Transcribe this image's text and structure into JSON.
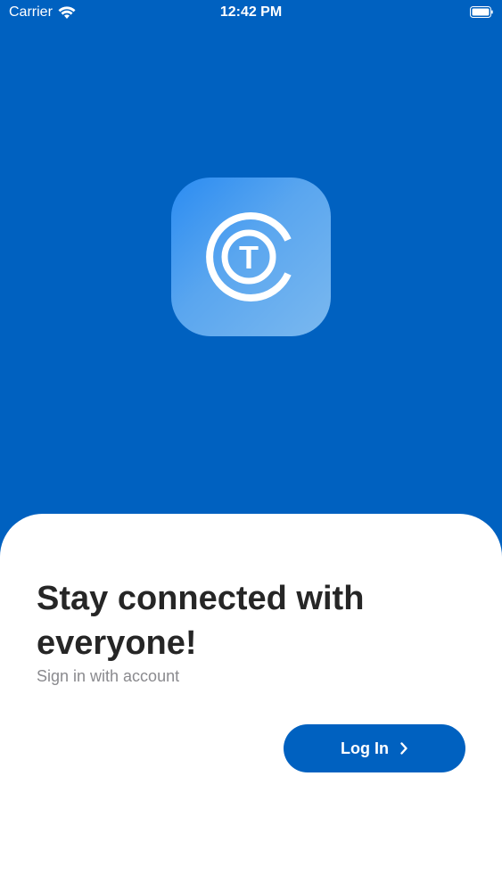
{
  "status_bar": {
    "carrier": "Carrier",
    "time": "12:42 PM",
    "wifi_icon": "wifi-icon",
    "battery_icon": "battery-icon"
  },
  "app_icon": {
    "icon": "ct-logo-icon",
    "letter": "T"
  },
  "sheet": {
    "headline": "Stay connected with everyone!",
    "subtitle": "Sign in with account",
    "login_label": "Log In",
    "login_icon": "chevron-right-icon"
  },
  "colors": {
    "background": "#0061c0",
    "button": "#0061c0",
    "sheet": "#ffffff",
    "headline": "#262626",
    "subtitle": "#8a8a8e"
  }
}
